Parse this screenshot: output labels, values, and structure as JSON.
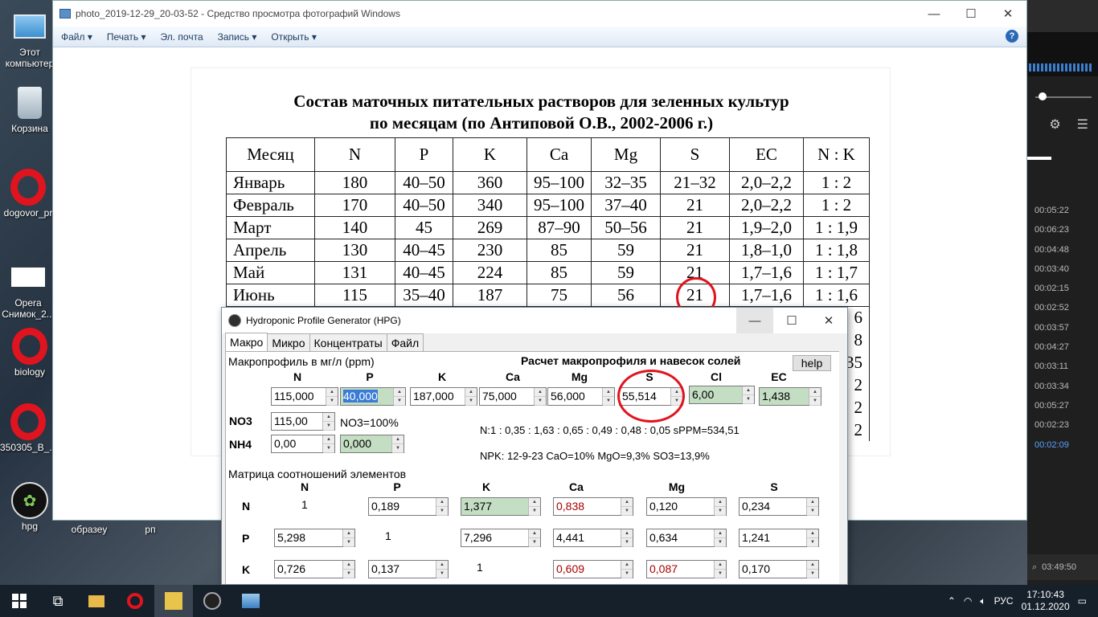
{
  "desktop": {
    "icons": [
      {
        "label": "Этот компьютер",
        "icon": "computer-icon"
      },
      {
        "label": "Корзина",
        "icon": "recycle-bin-icon"
      },
      {
        "label": "dogovor_pr",
        "icon": "opera-icon"
      },
      {
        "label": "Opera Снимок_2...",
        "icon": "opera-snapshot-icon"
      },
      {
        "label": "biology",
        "icon": "opera-icon"
      },
      {
        "label": "350305_B_...",
        "icon": "opera-icon"
      },
      {
        "label": "hpg",
        "icon": "hpg-icon"
      },
      {
        "label": "образеу",
        "icon": "folder-icon"
      },
      {
        "label": "рп",
        "icon": "folder-icon"
      }
    ]
  },
  "viewer": {
    "title": "photo_2019-12-29_20-03-52 - Средство просмотра фотографий Windows",
    "menu": [
      "Файл ▾",
      "Печать ▾",
      "Эл. почта",
      "Запись ▾",
      "Открыть ▾"
    ],
    "photo": {
      "title_line1": "Состав маточных питательных растворов для зеленных культур",
      "title_line2": "по месяцам (по Антиповой О.В., 2002-2006 г.)",
      "headers": [
        "Месяц",
        "N",
        "P",
        "K",
        "Ca",
        "Mg",
        "S",
        "EC",
        "N : K"
      ],
      "rows": [
        [
          "Январь",
          "180",
          "40–50",
          "360",
          "95–100",
          "32–35",
          "21–32",
          "2,0–2,2",
          "1 : 2"
        ],
        [
          "Февраль",
          "170",
          "40–50",
          "340",
          "95–100",
          "37–40",
          "21",
          "2,0–2,2",
          "1 : 2"
        ],
        [
          "Март",
          "140",
          "45",
          "269",
          "87–90",
          "50–56",
          "21",
          "1,9–2,0",
          "1 : 1,9"
        ],
        [
          "Апрель",
          "130",
          "40–45",
          "230",
          "85",
          "59",
          "21",
          "1,8–1,0",
          "1 : 1,8"
        ],
        [
          "Май",
          "131",
          "40–45",
          "224",
          "85",
          "59",
          "21",
          "1,7–1,6",
          "1 : 1,7"
        ],
        [
          "Июнь",
          "115",
          "35–40",
          "187",
          "75",
          "56",
          "21",
          "1,7–1,6",
          "1 : 1,6"
        ]
      ],
      "partial_right_cells": [
        "6",
        "8",
        "35",
        "2",
        "2",
        "2"
      ]
    }
  },
  "media_panel": {
    "times": [
      "00:05:22",
      "00:06:23",
      "00:04:48",
      "00:03:40",
      "00:02:15",
      "00:02:52",
      "00:03:57",
      "00:04:27",
      "00:03:11",
      "00:03:34",
      "00:05:27",
      "00:02:23",
      "00:02:09"
    ],
    "active_index": 12,
    "bottom_time": "03:49:50"
  },
  "hpg": {
    "title": "Hydroponic Profile Generator (HPG)",
    "tabs": [
      "Макро",
      "Микро",
      "Концентраты",
      "Файл"
    ],
    "active_tab": "Макро",
    "macro_label": "Макропрофиль в мг/л (ppm)",
    "calc_label": "Расчет макропрофиля и навесок солей",
    "help_label": "help",
    "headers": [
      "N",
      "P",
      "K",
      "Ca",
      "Mg",
      "S",
      "Cl",
      "EC"
    ],
    "values": [
      "115,000",
      "40,000",
      "187,000",
      "75,000",
      "56,000",
      "55,514",
      "6,00",
      "1,438"
    ],
    "no3_label": "NO3",
    "no3_value": "115,00",
    "no3_pct": "NO3=100%",
    "nh4_label": "NH4",
    "nh4_value": "0,00",
    "nh4_pct": "0,000",
    "ratio_text": "N:1 : 0,35 : 1,63 : 0,65 : 0,49 : 0,48 : 0,05 sPPM=534,51",
    "npk_text": "NPK: 12-9-23 CaO=10% MgO=9,3% SO3=13,9%",
    "matrix_label": "Матрица соотношений элементов",
    "matrix_cols": [
      "N",
      "P",
      "K",
      "Ca",
      "Mg",
      "S"
    ],
    "matrix_rows": [
      {
        "label": "N",
        "cells": [
          "1",
          "0,189",
          "1,377",
          "0,838",
          "0,120",
          "0,234"
        ]
      },
      {
        "label": "P",
        "cells": [
          "5,298",
          "1",
          "7,296",
          "4,441",
          "0,634",
          "1,241"
        ]
      },
      {
        "label": "K",
        "cells": [
          "0,726",
          "0,137",
          "1",
          "0,609",
          "0,087",
          "0,170"
        ]
      }
    ]
  },
  "taskbar": {
    "lang": "РУС",
    "time": "17:10:43",
    "date": "01.12.2020"
  },
  "colors": {
    "accent_red": "#e0141e",
    "green_field": "#c3dec3",
    "active_time": "#5aa2ff"
  }
}
